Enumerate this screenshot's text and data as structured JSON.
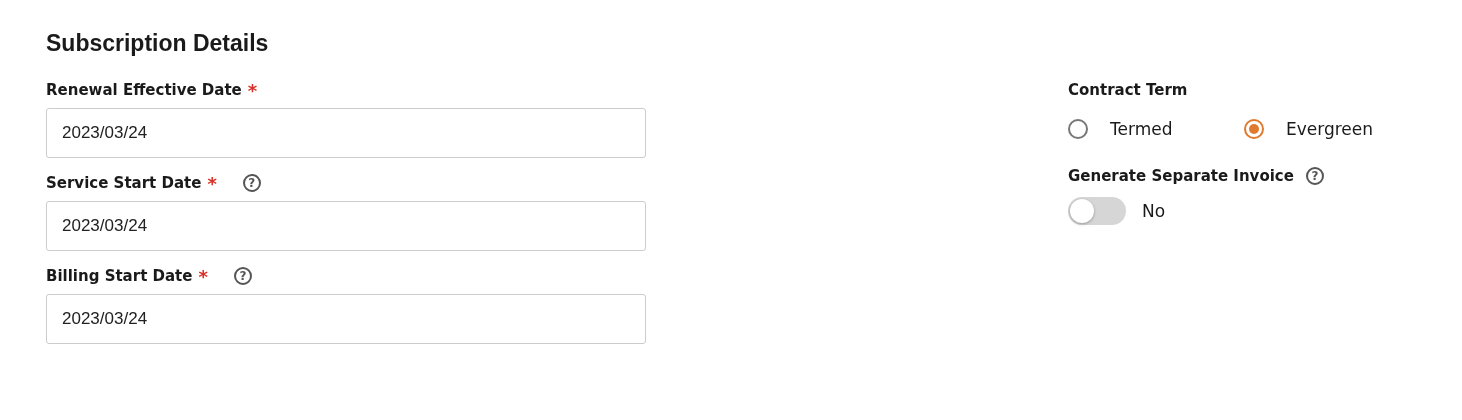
{
  "section": {
    "title": "Subscription Details"
  },
  "fields": [
    {
      "label": "Renewal Effective Date",
      "required_mark": "*",
      "value": "2023/03/24"
    },
    {
      "label": "Service Start Date",
      "required_mark": "*",
      "help_icon": "?",
      "value": "2023/03/24"
    },
    {
      "label": "Billing Start Date",
      "required_mark": "*",
      "help_icon": "?",
      "value": "2023/03/24"
    }
  ],
  "contract_term": {
    "label": "Contract Term",
    "options": [
      {
        "label": "Termed",
        "selected": false
      },
      {
        "label": "Evergreen",
        "selected": true
      }
    ]
  },
  "separate_invoice": {
    "label": "Generate Separate Invoice",
    "help_icon": "?",
    "on": false,
    "value_label": "No"
  }
}
